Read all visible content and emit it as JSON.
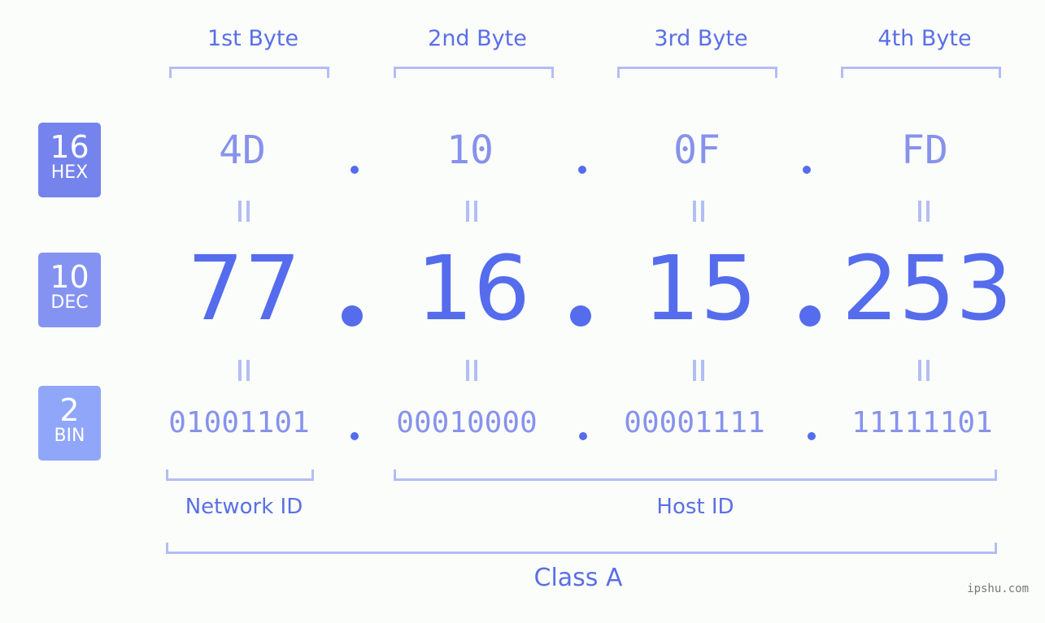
{
  "bytes": [
    {
      "label": "1st Byte",
      "hex": "4D",
      "dec": "77",
      "bin": "01001101"
    },
    {
      "label": "2nd Byte",
      "hex": "10",
      "dec": "16",
      "bin": "00010000"
    },
    {
      "label": "3rd Byte",
      "hex": "0F",
      "dec": "15",
      "bin": "00001111"
    },
    {
      "label": "4th Byte",
      "hex": "FD",
      "dec": "253",
      "bin": "11111101"
    }
  ],
  "badges": {
    "hex": {
      "num": "16",
      "label": "HEX",
      "color": "#7583ec"
    },
    "dec": {
      "num": "10",
      "label": "DEC",
      "color": "#8493f2"
    },
    "bin": {
      "num": "2",
      "label": "BIN",
      "color": "#90a6f8"
    }
  },
  "segments": {
    "network": "Network ID",
    "host": "Host ID",
    "class": "Class A"
  },
  "watermark": "ipshu.com"
}
